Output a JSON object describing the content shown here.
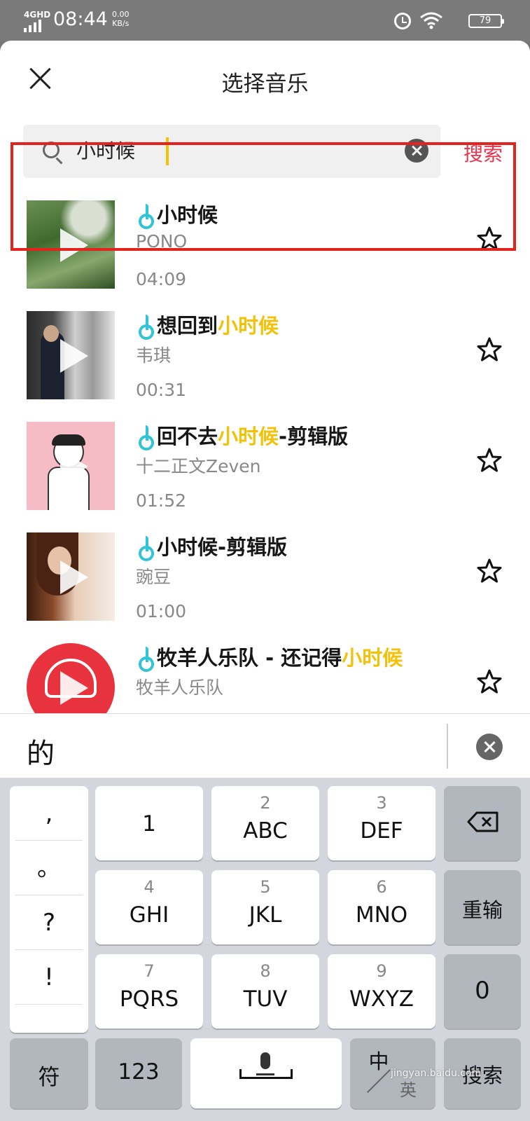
{
  "status_bar": {
    "network": "4GHD",
    "time": "08:44",
    "speed_value": "0.00",
    "speed_unit": "KB/s",
    "battery": "79"
  },
  "header": {
    "title": "选择音乐",
    "close_icon": "close-icon"
  },
  "search": {
    "query": "小时候",
    "button_label": "搜索",
    "accent_color": "#e8344e"
  },
  "results": [
    {
      "title_parts": [
        "小时候",
        "",
        ""
      ],
      "artist": "PONO",
      "duration": "04:09",
      "selected": true
    },
    {
      "title_parts": [
        "想回到",
        "小时候",
        ""
      ],
      "artist": "韦琪",
      "duration": "00:31",
      "selected": false
    },
    {
      "title_parts": [
        "回不去",
        "小时候",
        "-剪辑版"
      ],
      "artist": "十二正文Zeven",
      "duration": "01:52",
      "selected": false
    },
    {
      "title_parts": [
        "小时候-剪辑版",
        "",
        ""
      ],
      "artist": "豌豆",
      "duration": "01:00",
      "selected": false
    },
    {
      "title_parts": [
        "牧羊人乐队 - 还记得",
        "小时候",
        ""
      ],
      "artist": "牧羊人乐队",
      "duration": "",
      "selected": false
    }
  ],
  "highlight_color": "#f2c20a",
  "candidate": {
    "word": "的"
  },
  "keyboard": {
    "punct": [
      ",",
      "。",
      "?",
      "!"
    ],
    "rows": [
      [
        {
          "num": "",
          "letters": "1"
        },
        {
          "num": "2",
          "letters": "ABC"
        },
        {
          "num": "3",
          "letters": "DEF"
        }
      ],
      [
        {
          "num": "4",
          "letters": "GHI"
        },
        {
          "num": "5",
          "letters": "JKL"
        },
        {
          "num": "6",
          "letters": "MNO"
        }
      ],
      [
        {
          "num": "7",
          "letters": "PQRS"
        },
        {
          "num": "8",
          "letters": "TUV"
        },
        {
          "num": "9",
          "letters": "WXYZ"
        }
      ]
    ],
    "reinput": "重输",
    "zero": "0",
    "symbols": "符",
    "numbers": "123",
    "lang_zh": "中",
    "lang_en": "英",
    "search": "搜索"
  },
  "watermark": "jingyan.baidu.com"
}
